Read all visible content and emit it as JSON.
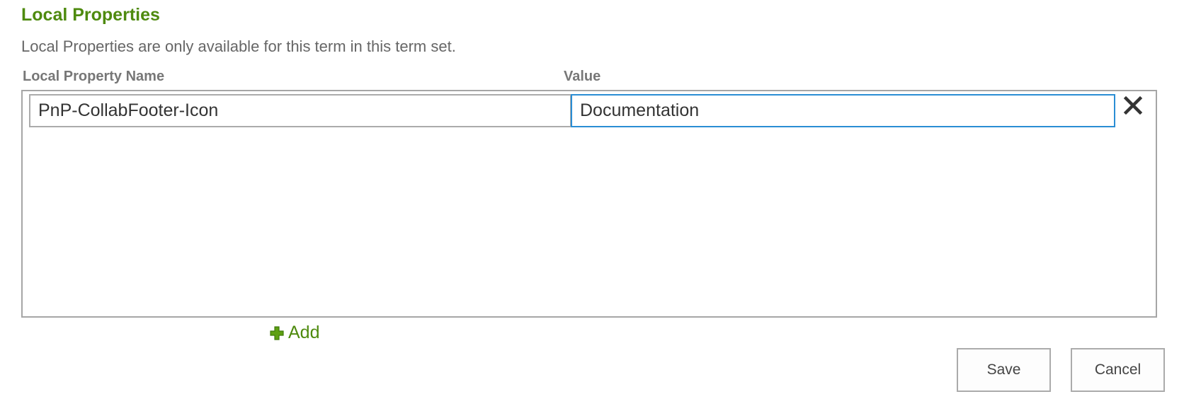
{
  "section": {
    "title": "Local Properties",
    "description": "Local Properties are only available for this term in this term set."
  },
  "table": {
    "columns": {
      "name": "Local Property Name",
      "value": "Value"
    },
    "rows": [
      {
        "name": "PnP-CollabFooter-Icon",
        "value": "Documentation",
        "remove_icon": "close-x-icon"
      }
    ]
  },
  "add": {
    "label": "Add",
    "icon": "plus-icon",
    "icon_color": "#4e8a0e"
  },
  "buttons": {
    "save": "Save",
    "cancel": "Cancel"
  },
  "colors": {
    "accent": "#4e8a0e",
    "focus_border": "#2a8dd4"
  }
}
